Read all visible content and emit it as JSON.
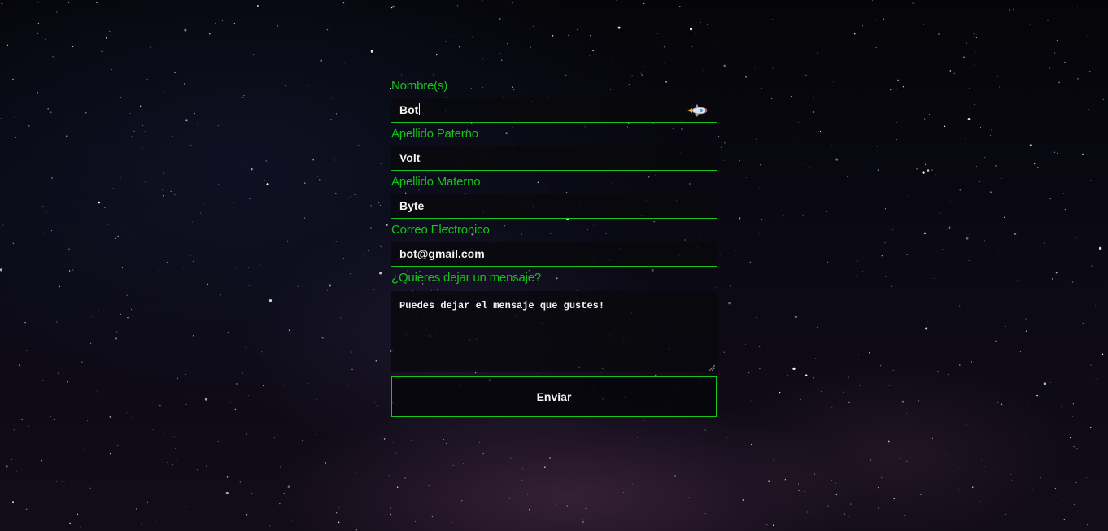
{
  "form": {
    "fields": [
      {
        "label": "Nombre(s)",
        "value": "Bot"
      },
      {
        "label": "Apellido Paterno",
        "value": "Volt"
      },
      {
        "label": "Apellido Materno",
        "value": "Byte"
      },
      {
        "label": "Correo Electronico",
        "value": "bot@gmail.com"
      }
    ],
    "message": {
      "label": "¿Quieres dejar un mensaje?",
      "value": "Puedes dejar el mensaje que gustes!"
    },
    "submit_label": "Enviar"
  },
  "icons": {
    "autofill": "rocket-icon",
    "resize": "resize-grip-icon"
  },
  "colors": {
    "accent": "#16c41a",
    "text": "#f2f2f2",
    "field_bg": "#08080c"
  }
}
